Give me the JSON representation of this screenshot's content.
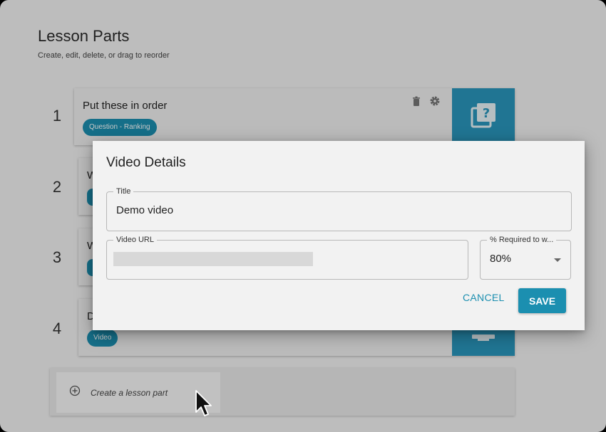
{
  "header": {
    "title": "Lesson Parts",
    "subtitle": "Create, edit, delete, or drag to reorder"
  },
  "parts": [
    {
      "number": "1",
      "title": "Put these in order",
      "badge": "Question - Ranking",
      "thumb_icon": "question-stack-icon"
    },
    {
      "number": "2",
      "title": "W",
      "badge": "",
      "thumb_icon": ""
    },
    {
      "number": "3",
      "title": "W",
      "badge": "",
      "thumb_icon": ""
    },
    {
      "number": "4",
      "title": "D",
      "badge": "Video",
      "thumb_icon": "monitor-icon"
    }
  ],
  "part_actions": {
    "delete_icon": "trash-icon",
    "settings_icon": "gear-icon"
  },
  "create": {
    "label": "Create a lesson part",
    "icon": "plus-circle-icon"
  },
  "dialog": {
    "title": "Video Details",
    "title_field": {
      "label": "Title",
      "value": "Demo video"
    },
    "url_field": {
      "label": "Video URL",
      "value": ""
    },
    "required_field": {
      "label": "% Required to w...",
      "value": "80%"
    },
    "cancel_label": "CANCEL",
    "save_label": "SAVE"
  },
  "colors": {
    "accent": "#1b8fb0",
    "thumb": "#2a97bd",
    "background": "#f2f2f2"
  }
}
